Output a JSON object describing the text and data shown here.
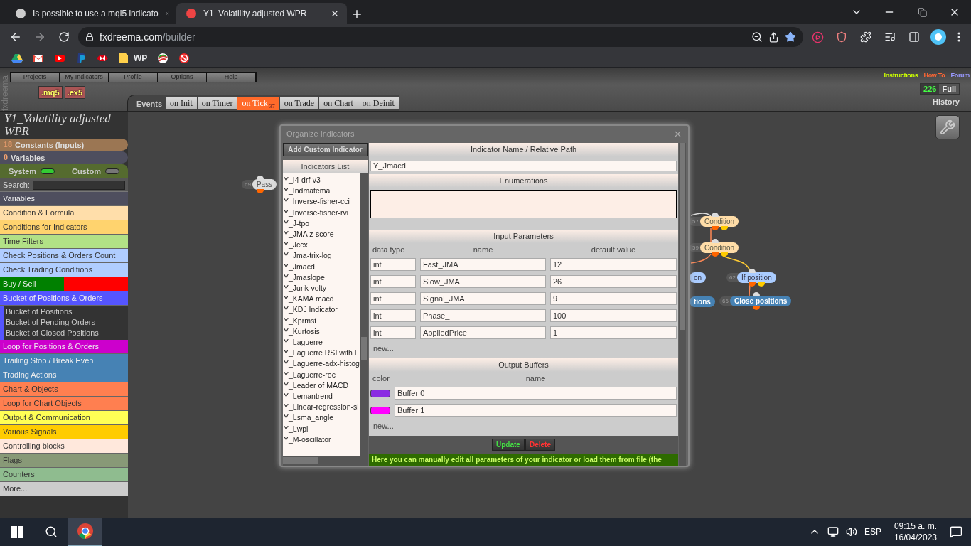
{
  "browser": {
    "tabs": [
      {
        "title": "Is possible to use a mql5 indicato",
        "selected": false
      },
      {
        "title": "Y1_Volatility adjusted WPR",
        "selected": true
      }
    ],
    "address": {
      "host": "fxdreema.com",
      "path": "/builder"
    },
    "bookmarks": [
      {
        "kind": "drive"
      },
      {
        "kind": "gmail"
      },
      {
        "kind": "youtube"
      },
      {
        "kind": "paypal"
      },
      {
        "kind": "hsbc"
      },
      {
        "kind": "folder",
        "label": "WP"
      },
      {
        "kind": "swirl"
      },
      {
        "kind": "block"
      }
    ]
  },
  "app": {
    "brand": "fxdreema",
    "menu": [
      "Projects",
      "My Indicators",
      "Profile",
      "Options",
      "Help"
    ],
    "exports": [
      ".mq5",
      ".ex5"
    ],
    "events": {
      "label": "Events",
      "tabs": [
        {
          "label": "on Init",
          "selected": false
        },
        {
          "label": "on Timer",
          "selected": false
        },
        {
          "label": "on Tick",
          "selected": true,
          "badge": "37"
        },
        {
          "label": "on Trade",
          "selected": false
        },
        {
          "label": "on Chart",
          "selected": false
        },
        {
          "label": "on Deinit",
          "selected": false
        }
      ]
    },
    "links": [
      {
        "label": "Instructions",
        "color": "#ccff00"
      },
      {
        "label": "How To",
        "color": "#ff6633"
      },
      {
        "label": "Forum",
        "color": "#9999ff"
      }
    ],
    "counter": {
      "value": "226",
      "label": "Full"
    },
    "history": "History"
  },
  "sidebar": {
    "title": "Y1_Volatility adjusted WPR",
    "constants": {
      "count": "18",
      "label": "Constants (Inputs)"
    },
    "variables": {
      "count": "0",
      "label": "Variables"
    },
    "toggles": [
      {
        "label": "System",
        "on": true
      },
      {
        "label": "Custom",
        "on": false
      }
    ],
    "search": {
      "label": "Search:"
    },
    "categories": [
      {
        "label": "Variables",
        "color": "#4e4e5e"
      },
      {
        "label": "Condition & Formula",
        "color": "#ffdeaa"
      },
      {
        "label": "Conditions for Indicators",
        "color": "#ffd36e"
      },
      {
        "label": "Time Filters",
        "color": "#b2e186"
      },
      {
        "label": "Check Positions & Orders Count",
        "color": "#b0cdff"
      },
      {
        "label": "Check Trading Conditions",
        "color": "#b0cdff"
      },
      {
        "label": "Buy / Sell",
        "color": "#008000",
        "split": {
          "color": "#ff0000"
        }
      },
      {
        "label": "Bucket of Positions & Orders",
        "color": "#5555ff",
        "children": [
          {
            "label": "Bucket of Positions"
          },
          {
            "label": "Bucket of Pending Orders"
          },
          {
            "label": "Bucket of Closed Positions"
          }
        ]
      },
      {
        "label": "Loop for Positions & Orders",
        "color": "#cc00cc"
      },
      {
        "label": "Trailing Stop / Break Even",
        "color": "#4682b4"
      },
      {
        "label": "Trading Actions",
        "color": "#4682b4"
      },
      {
        "label": "Chart & Objects",
        "color": "#ff7f50"
      },
      {
        "label": "Loop for Chart Objects",
        "color": "#ff7f50"
      },
      {
        "label": "Output & Communication",
        "color": "#ffff55"
      },
      {
        "label": "Various Signals",
        "color": "#ffcc00"
      },
      {
        "label": "Controlling blocks",
        "color": "#ffe8dc"
      },
      {
        "label": "Flags",
        "color": "#889977"
      },
      {
        "label": "Counters",
        "color": "#8fbc8f"
      },
      {
        "label": "More...",
        "color": "#cccccc"
      }
    ]
  },
  "canvas": {
    "nodes": [
      {
        "number": "69",
        "label": "Pass",
        "kind": "pass"
      },
      {
        "number": "57",
        "label": "Condition",
        "kind": "condition"
      },
      {
        "number": "59",
        "label": "Condition",
        "kind": "condition"
      },
      {
        "label": "on",
        "kind": "filter"
      },
      {
        "number": "62",
        "label": "If position",
        "kind": "filter"
      },
      {
        "label": "tions",
        "kind": "action"
      },
      {
        "number": "66",
        "label": "Close positions",
        "kind": "action"
      }
    ]
  },
  "dialog": {
    "title": "Organize Indicators",
    "add_button": "Add Custom Indicator",
    "list_title": "Indicators List",
    "indicators": [
      "Y_I4-drf-v3",
      "Y_Indmatema",
      "Y_Inverse-fisher-cci",
      "Y_Inverse-fisher-rvi",
      "Y_J-tpo",
      "Y_JMA z-score",
      "Y_Jccx",
      "Y_Jma-trix-log",
      "Y_Jmacd",
      "Y_Jmaslope",
      "Y_Jurik-volty",
      "Y_KAMA macd",
      "Y_KDJ Indicator",
      "Y_Kprmst",
      "Y_Kurtosis",
      "Y_Laguerre",
      "Y_Laguerre RSI with L",
      "Y_Laguerre-adx-histog",
      "Y_Laguerre-roc",
      "Y_Leader of MACD",
      "Y_Lemantrend",
      "Y_Linear-regression-sl",
      "Y_Lsma_angle",
      "Y_Lwpi",
      "Y_M-oscillator"
    ],
    "name_section": {
      "title": "Indicator Name / Relative Path",
      "value": "Y_Jmacd"
    },
    "enumerations": {
      "title": "Enumerations"
    },
    "inputs": {
      "title": "Input Parameters",
      "columns": [
        "data type",
        "name",
        "default value"
      ],
      "rows": [
        {
          "type": "int",
          "name": "Fast_JMA",
          "value": "12"
        },
        {
          "type": "int",
          "name": "Slow_JMA",
          "value": "26"
        },
        {
          "type": "int",
          "name": "Signal_JMA",
          "value": "9"
        },
        {
          "type": "int",
          "name": "Phase_",
          "value": "100"
        },
        {
          "type": "int",
          "name": "AppliedPrice",
          "value": "1"
        }
      ],
      "new": "new..."
    },
    "buffers": {
      "title": "Output Buffers",
      "columns": [
        "color",
        "name"
      ],
      "rows": [
        {
          "color": "#8a2be2",
          "name": "Buffer 0"
        },
        {
          "color": "#ff00ff",
          "name": "Buffer 1"
        }
      ],
      "new": "new..."
    },
    "buttons": [
      {
        "label": "Update",
        "kind": "update"
      },
      {
        "label": "Delete",
        "kind": "delete"
      }
    ],
    "note": "Here you can manually edit all parameters of your indicator or load them from file (the"
  },
  "taskbar": {
    "language": "ESP",
    "time": "09:15 a. m.",
    "date": "16/04/2023"
  }
}
